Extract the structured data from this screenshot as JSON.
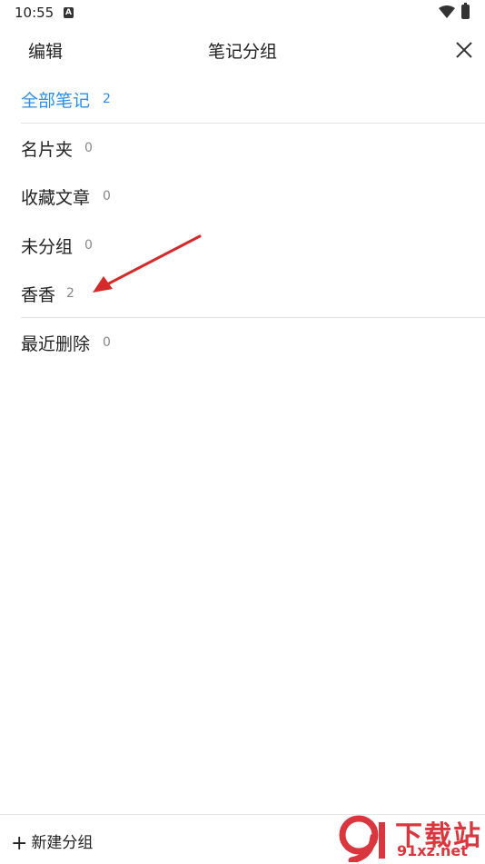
{
  "status_bar": {
    "time": "10:55"
  },
  "header": {
    "edit_label": "编辑",
    "title": "笔记分组"
  },
  "groups": [
    {
      "name": "全部笔记",
      "count": "2",
      "active": true
    },
    {
      "name": "名片夹",
      "count": "0"
    },
    {
      "name": "收藏文章",
      "count": "0"
    },
    {
      "name": "未分组",
      "count": "0"
    },
    {
      "name": "香香",
      "count": "2"
    },
    {
      "name": "最近删除",
      "count": "0"
    }
  ],
  "footer": {
    "new_group_label": "新建分组"
  },
  "watermark": {
    "title": "下载站",
    "url": "91xz.net"
  },
  "colors": {
    "accent": "#2f8ee6",
    "arrow": "#d42a2a",
    "watermark": "#d9363e"
  },
  "icons": [
    "status-a-icon",
    "wifi-icon",
    "battery-icon",
    "close-icon",
    "plus-icon",
    "red-arrow-annotation"
  ]
}
